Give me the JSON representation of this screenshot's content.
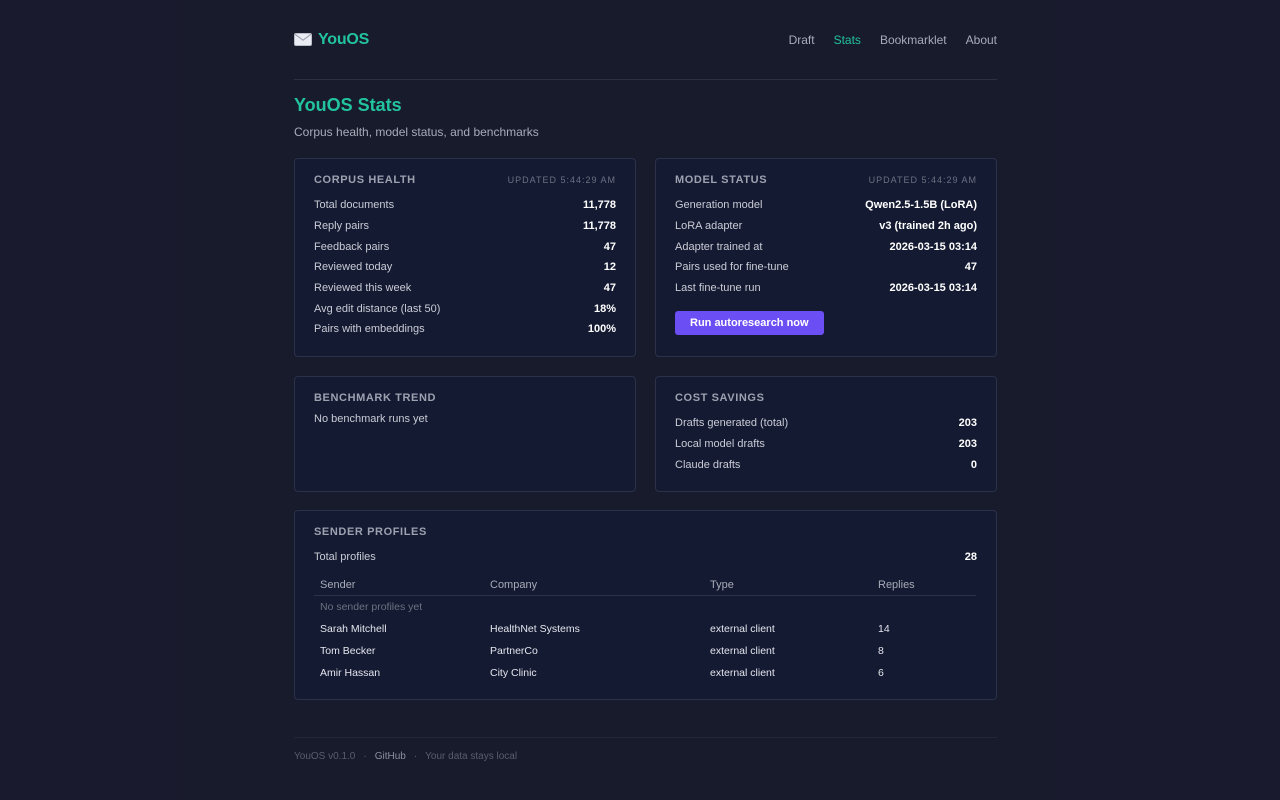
{
  "brand": {
    "name": "YouOS",
    "icon": "envelope-icon"
  },
  "nav": [
    {
      "label": "Draft",
      "active": false
    },
    {
      "label": "Stats",
      "active": true
    },
    {
      "label": "Bookmarklet",
      "active": false
    },
    {
      "label": "About",
      "active": false
    }
  ],
  "page": {
    "title": "YouOS Stats",
    "subtitle": "Corpus health, model status, and benchmarks"
  },
  "corpus": {
    "title": "Corpus Health",
    "updated": "Updated 5:44:29 AM",
    "rows": [
      {
        "label": "Total documents",
        "value": "11,778"
      },
      {
        "label": "Reply pairs",
        "value": "11,778"
      },
      {
        "label": "Feedback pairs",
        "value": "47"
      },
      {
        "label": "Reviewed today",
        "value": "12"
      },
      {
        "label": "Reviewed this week",
        "value": "47"
      },
      {
        "label": "Avg edit distance (last 50)",
        "value": "18%"
      },
      {
        "label": "Pairs with embeddings",
        "value": "100%"
      }
    ]
  },
  "model": {
    "title": "Model Status",
    "updated": "Updated 5:44:29 AM",
    "rows": [
      {
        "label": "Generation model",
        "value": "Qwen2.5-1.5B (LoRA)"
      },
      {
        "label": "LoRA adapter",
        "value": "v3 (trained 2h ago)"
      },
      {
        "label": "Adapter trained at",
        "value": "2026-03-15 03:14"
      },
      {
        "label": "Pairs used for fine-tune",
        "value": "47"
      },
      {
        "label": "Last fine-tune run",
        "value": "2026-03-15 03:14"
      }
    ],
    "button_label": "Run autoresearch now"
  },
  "benchmark": {
    "title": "Benchmark Trend",
    "empty": "No benchmark runs yet"
  },
  "cost": {
    "title": "Cost Savings",
    "rows": [
      {
        "label": "Drafts generated (total)",
        "value": "203"
      },
      {
        "label": "Local model drafts",
        "value": "203"
      },
      {
        "label": "Claude drafts",
        "value": "0"
      }
    ]
  },
  "senders": {
    "title": "Sender Profiles",
    "total_label": "Total profiles",
    "total_value": "28",
    "columns": [
      "Sender",
      "Company",
      "Type",
      "Replies"
    ],
    "empty": "No sender profiles yet",
    "rows": [
      {
        "sender": "Sarah Mitchell",
        "company": "HealthNet Systems",
        "type": "external client",
        "replies": "14"
      },
      {
        "sender": "Tom Becker",
        "company": "PartnerCo",
        "type": "external client",
        "replies": "8"
      },
      {
        "sender": "Amir Hassan",
        "company": "City Clinic",
        "type": "external client",
        "replies": "6"
      }
    ]
  },
  "footer": {
    "version": "YouOS v0.1.0",
    "sep": "·",
    "github": "GitHub",
    "tagline": "Your data stays local"
  },
  "colors": {
    "accent": "#22c3a0",
    "button": "#6c4ef5",
    "card_bg": "#141a31",
    "page_bg": "#1a1a2e"
  }
}
